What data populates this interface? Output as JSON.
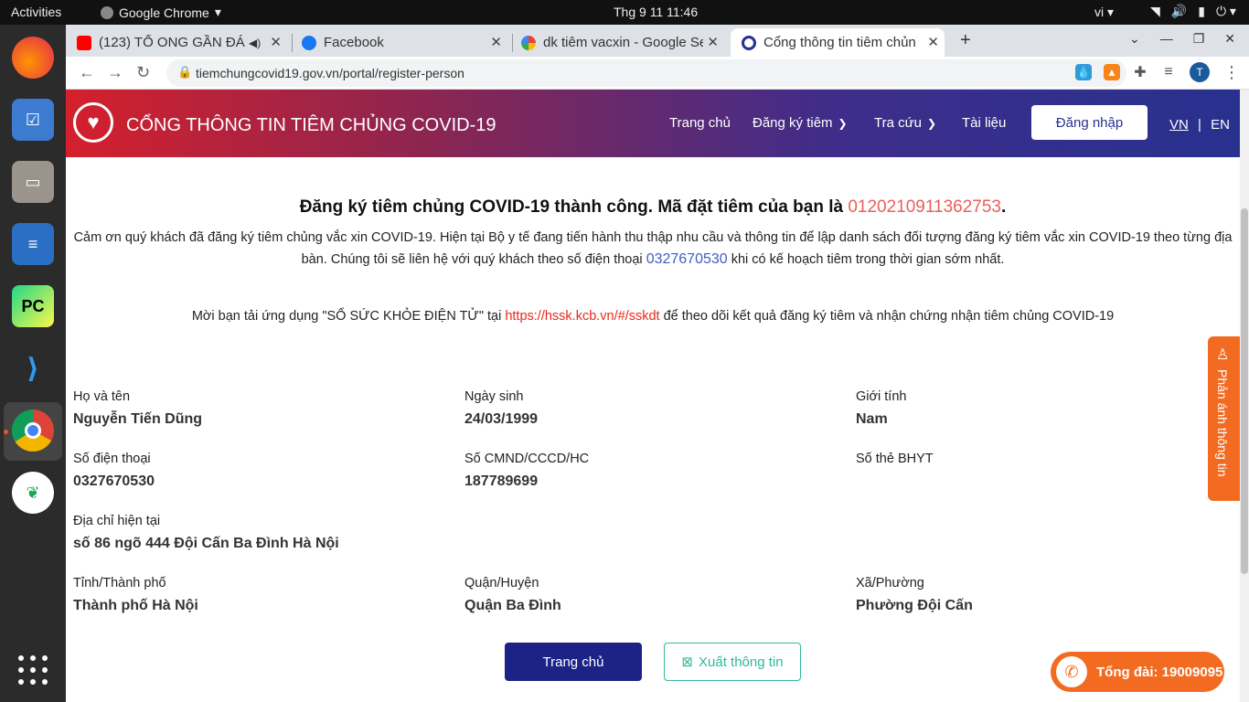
{
  "system": {
    "activities": "Activities",
    "app_name": "Google Chrome",
    "clock": "Thg 9 11  11:46",
    "lang": "vi",
    "tray_icons": [
      "wifi-icon",
      "volume-icon",
      "battery-icon",
      "power-icon"
    ]
  },
  "dock": {
    "items": [
      "firefox",
      "tasks",
      "files",
      "writer",
      "pycharm",
      "vscode",
      "chrome",
      "mongodb-compass"
    ]
  },
  "browser": {
    "tabs": [
      {
        "title": "(123) TỔ ONG GẦN ĐÁ",
        "favicon": "youtube-icon"
      },
      {
        "title": "Facebook",
        "favicon": "facebook-icon"
      },
      {
        "title": "dk tiêm vacxin - Google Se",
        "favicon": "google-icon"
      },
      {
        "title": "Cổng thông tin tiêm chủn",
        "favicon": "covid-portal-icon"
      }
    ],
    "url": "tiemchungcovid19.gov.vn/portal/register-person",
    "profile_initial": "T"
  },
  "site": {
    "brand": "CỔNG THÔNG TIN TIÊM CHỦNG COVID-19",
    "nav": {
      "home": "Trang chủ",
      "register": "Đăng ký tiêm",
      "lookup": "Tra cứu",
      "docs": "Tài liệu",
      "login": "Đăng nhập",
      "lang_vn": "VN",
      "lang_sep": "|",
      "lang_en": "EN"
    },
    "success": {
      "prefix": "Đăng ký tiêm chủng COVID-19 thành công. Mã đặt tiêm của bạn là ",
      "code": "0120210911362753",
      "suffix": "."
    },
    "thanks": {
      "before": "Cảm ơn quý khách đã đăng ký tiêm chủng vắc xin COVID-19. Hiện tại Bộ y tế đang tiến hành thu thập nhu cầu và thông tin để lập danh sách đối tượng đăng ký tiêm vắc xin COVID-19 theo từng địa bàn. Chúng tôi sẽ liên hệ với quý khách theo số điện thoại ",
      "phone": "0327670530",
      "after": " khi có kế hoạch tiêm trong thời gian sớm nhất."
    },
    "app_line": {
      "before": "Mời bạn tải ứng dụng \"SỔ SỨC KHỎE ĐIỆN TỬ\" tại ",
      "link": "https://hssk.kcb.vn/#/sskdt",
      "after": " để theo dõi kết quả đăng ký tiêm và nhận chứng nhận tiêm chủng COVID-19"
    },
    "fields": {
      "name": {
        "label": "Họ và tên",
        "value": "Nguyễn Tiến Dũng"
      },
      "dob": {
        "label": "Ngày sinh",
        "value": "24/03/1999"
      },
      "gender": {
        "label": "Giới tính",
        "value": "Nam"
      },
      "phone": {
        "label": "Số điện thoại",
        "value": "0327670530"
      },
      "idcard": {
        "label": "Số CMND/CCCD/HC",
        "value": "187789699"
      },
      "insurance": {
        "label": "Số thẻ BHYT",
        "value": ""
      },
      "address": {
        "label": "Địa chỉ hiện tại",
        "value": "số 86 ngõ 444 Đội Cấn Ba Đình Hà Nội"
      },
      "province": {
        "label": "Tỉnh/Thành phố",
        "value": "Thành phố Hà Nội"
      },
      "district": {
        "label": "Quận/Huyện",
        "value": "Quận Ba Đình"
      },
      "ward": {
        "label": "Xã/Phường",
        "value": "Phường Đội Cấn"
      }
    },
    "buttons": {
      "home": "Trang chủ",
      "export": "Xuất thông tin"
    },
    "feedback": "Phản ánh thông tin",
    "hotline": "Tổng đài: 19009095"
  }
}
